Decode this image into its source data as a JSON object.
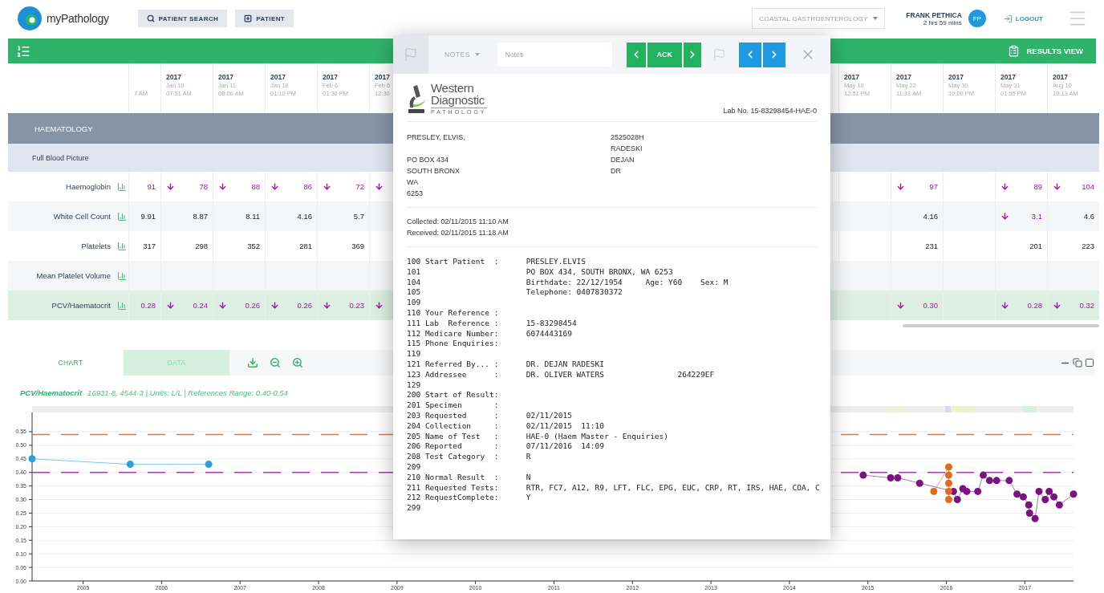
{
  "header": {
    "app_name": "myPathology",
    "buttons": [
      {
        "label": "PATIENT SEARCH"
      },
      {
        "label": "PATIENT"
      }
    ],
    "practice": "COASTAL GASTROENTEROLOGY",
    "user": {
      "name": "FRANK PETHICA",
      "session": "2 hrs 59 mins",
      "initials": "FP"
    },
    "logout": "LOGOUT"
  },
  "toolbar": {
    "view_button": "RESULTS VIEW"
  },
  "results": {
    "left_columns": [
      {
        "time": "7 AM"
      },
      {
        "year": "2017",
        "date": "Jan 10",
        "time": "07:51 AM"
      },
      {
        "year": "2017",
        "date": "Jan 11",
        "time": "08:00 AM"
      },
      {
        "year": "2017",
        "date": "Jan 18",
        "time": "01:10 PM"
      },
      {
        "year": "2017",
        "date": "Feb 6",
        "time": "01:30 PM"
      },
      {
        "year": "2017",
        "date": "Feb 6",
        "time": "12:30"
      }
    ],
    "right_columns": [
      {
        "year": "2017",
        "date": "May 10",
        "time": "12:51 PM"
      },
      {
        "year": "2017",
        "date": "May 22",
        "time": "11:31 AM"
      },
      {
        "year": "2017",
        "date": "May 30",
        "time": "10:00 PM"
      },
      {
        "year": "2017",
        "date": "May 31",
        "time": "01:55 PM"
      },
      {
        "year": "2017",
        "date": "Aug 10",
        "time": "10:13 AM"
      }
    ],
    "group": "HAEMATOLOGY",
    "subgroup": "Full Blood Picture",
    "rows": [
      {
        "name": "Haemoglobin",
        "selected": false,
        "left_cells": [
          {
            "value": "91",
            "arrow": false,
            "abnormal": true
          },
          {
            "value": "78",
            "arrow": true,
            "abnormal": true
          },
          {
            "value": "88",
            "arrow": true,
            "abnormal": true
          },
          {
            "value": "86",
            "arrow": true,
            "abnormal": true
          },
          {
            "value": "72",
            "arrow": true,
            "abnormal": true
          },
          {
            "arrow": true,
            "abnormal": true
          }
        ],
        "right_cells": [
          null,
          {
            "value": "97",
            "arrow": true,
            "abnormal": true
          },
          null,
          {
            "value": "89",
            "arrow": true,
            "abnormal": true
          },
          {
            "value": "104",
            "arrow": true,
            "abnormal": true
          }
        ]
      },
      {
        "name": "White Cell Count",
        "selected": false,
        "left_cells": [
          {
            "value": "9.91",
            "arrow": false,
            "abnormal": false
          },
          {
            "value": "8.87",
            "arrow": false,
            "abnormal": false
          },
          {
            "value": "8.11",
            "arrow": false,
            "abnormal": false
          },
          {
            "value": "4.16",
            "arrow": false,
            "abnormal": false
          },
          {
            "value": "5.7",
            "arrow": false,
            "abnormal": false
          },
          null
        ],
        "right_cells": [
          null,
          {
            "value": "4.16",
            "arrow": false,
            "abnormal": false
          },
          null,
          {
            "value": "3.1",
            "arrow": true,
            "abnormal": true
          },
          {
            "value": "4.6",
            "arrow": false,
            "abnormal": false
          }
        ]
      },
      {
        "name": "Platelets",
        "selected": false,
        "left_cells": [
          {
            "value": "317",
            "arrow": false,
            "abnormal": false
          },
          {
            "value": "298",
            "arrow": false,
            "abnormal": false
          },
          {
            "value": "352",
            "arrow": false,
            "abnormal": false
          },
          {
            "value": "281",
            "arrow": false,
            "abnormal": false
          },
          {
            "value": "369",
            "arrow": false,
            "abnormal": false
          },
          null
        ],
        "right_cells": [
          null,
          {
            "value": "231",
            "arrow": false,
            "abnormal": false
          },
          null,
          {
            "value": "201",
            "arrow": false,
            "abnormal": false
          },
          {
            "value": "223",
            "arrow": false,
            "abnormal": false
          }
        ]
      },
      {
        "name": "Mean Platelet Volume",
        "selected": false,
        "left_cells": [
          null,
          null,
          null,
          null,
          null,
          null
        ],
        "right_cells": [
          null,
          null,
          null,
          null,
          null
        ]
      },
      {
        "name": "PCV/Haematocrit",
        "selected": true,
        "left_cells": [
          {
            "value": "0.28",
            "arrow": false,
            "abnormal": true
          },
          {
            "value": "0.24",
            "arrow": true,
            "abnormal": true
          },
          {
            "value": "0.26",
            "arrow": true,
            "abnormal": true
          },
          {
            "value": "0.26",
            "arrow": true,
            "abnormal": true
          },
          {
            "value": "0.23",
            "arrow": true,
            "abnormal": true
          },
          {
            "arrow": true,
            "abnormal": true
          }
        ],
        "right_cells": [
          null,
          {
            "value": "0.30",
            "arrow": true,
            "abnormal": true
          },
          null,
          {
            "value": "0.28",
            "arrow": true,
            "abnormal": true
          },
          {
            "value": "0.32",
            "arrow": true,
            "abnormal": true
          }
        ]
      }
    ]
  },
  "chart_panel": {
    "tabs": [
      {
        "label": "CHART",
        "selected": true
      },
      {
        "label": "DATA",
        "selected": false
      }
    ],
    "title": "PCV/Haematocrit",
    "details": "16931-8, 4544-3 | Units: L/L | References Range: 0.40-0.54",
    "chart_data": {
      "type": "line",
      "xlim": [
        2004.35,
        2017.62
      ],
      "ylim": [
        0,
        0.615
      ],
      "xticks": [
        2005,
        2006,
        2007,
        2008,
        2009,
        2010,
        2011,
        2012,
        2013,
        2014,
        2015,
        2016,
        2017
      ],
      "yticks": [
        {
          "value": 0,
          "label": "0.00"
        },
        {
          "value": 0.05,
          "label": "0.05"
        },
        {
          "value": 0.1,
          "label": "0.10"
        },
        {
          "value": 0.15,
          "label": "0.15"
        },
        {
          "value": 0.2,
          "label": "0.20"
        },
        {
          "value": 0.25,
          "label": "0.25"
        },
        {
          "value": 0.3,
          "label": "0.30"
        },
        {
          "value": 0.35,
          "label": "0.35"
        },
        {
          "value": 0.4,
          "label": "0.40"
        },
        {
          "value": 0.45,
          "label": "0.45"
        },
        {
          "value": 0.5,
          "label": "0.50"
        },
        {
          "value": 0.55,
          "label": "0.55"
        }
      ],
      "x": [
        2004.35,
        2005.6,
        2006.6,
        2014.94,
        2015.29,
        2015.38,
        2015.66,
        2015.84,
        2016.03,
        2016.03,
        2016.03,
        2016.03,
        2016.03,
        2016.09,
        2016.14,
        2016.21,
        2016.26,
        2016.4,
        2016.47,
        2016.55,
        2016.64,
        2016.8,
        2016.9,
        2016.98,
        2017.05,
        2017.06,
        2017.13,
        2017.18,
        2017.26,
        2017.31,
        2017.37,
        2017.44,
        2017.62
      ],
      "grid": true,
      "series": [
        {
          "color": "#2a9fe0",
          "marker": "o",
          "values": [
            0.45,
            0.43,
            0.43,
            null,
            null,
            null,
            null,
            null,
            null,
            null,
            null,
            null,
            null,
            null,
            null,
            null,
            null,
            null,
            null,
            null,
            null,
            null,
            null,
            null,
            null,
            null,
            null,
            null,
            null,
            null,
            null,
            null,
            null
          ]
        },
        {
          "color": "#7b1282",
          "marker": "o",
          "values": [
            null,
            null,
            null,
            0.39,
            0.38,
            0.38,
            0.36,
            null,
            null,
            null,
            null,
            null,
            null,
            0.33,
            0.3,
            0.34,
            0.33,
            0.33,
            0.39,
            0.37,
            0.37,
            0.37,
            0.32,
            0.31,
            0.28,
            0.25,
            0.23,
            0.33,
            0.3,
            0.33,
            0.31,
            0.28,
            0.32
          ]
        },
        {
          "color": "#e06a1e",
          "marker": "o",
          "values": [
            null,
            null,
            null,
            null,
            null,
            null,
            null,
            0.33,
            0.42,
            0.39,
            0.36,
            0.33,
            0.3,
            null,
            null,
            null,
            null,
            null,
            null,
            null,
            null,
            null,
            null,
            null,
            null,
            null,
            null,
            null,
            null,
            null,
            null,
            null,
            null
          ]
        },
        {
          "color": "#e0763a",
          "line_style": "dashed",
          "values": [
            0.54,
            0.54,
            0.54,
            0.54,
            0.54,
            0.54,
            0.54,
            0.54,
            0.54,
            0.54,
            0.54,
            0.54,
            0.54,
            0.54,
            0.54,
            0.54,
            0.54,
            0.54,
            0.54,
            0.54,
            0.54,
            0.54,
            0.54,
            0.54,
            0.54,
            0.54,
            0.54,
            0.54,
            0.54,
            0.54,
            0.54,
            0.54,
            0.54
          ]
        },
        {
          "color": "#a43cb0",
          "line_style": "dashed",
          "values": [
            0.4,
            0.4,
            0.4,
            0.4,
            0.4,
            0.4,
            0.4,
            0.4,
            0.4,
            0.4,
            0.4,
            0.4,
            0.4,
            0.4,
            0.4,
            0.4,
            0.4,
            0.4,
            0.4,
            0.4,
            0.4,
            0.4,
            0.4,
            0.4,
            0.4,
            0.4,
            0.4,
            0.4,
            0.4,
            0.4,
            0.4,
            0.4,
            0.4
          ]
        }
      ]
    }
  },
  "report_dialog": {
    "notes_menu": "NOTES",
    "notes_placeholder": "Notes",
    "ack": "ACK",
    "logo": {
      "line1": "Western",
      "line2": "Diagnostic",
      "line3": "PATHOLOGY"
    },
    "lab_no": "Lab No. 15-83298454-HAE-0",
    "patient": {
      "name": "PRESLEY, ELVIS,",
      "address": [
        "PO BOX 434",
        "SOUTH BRONX",
        "WA",
        "6253"
      ]
    },
    "doctor": [
      "2525028H",
      "RADESKI",
      "DEJAN",
      "DR"
    ],
    "collected": "Collected: 02/11/2015 11:10 AM",
    "received": "Received: 02/11/2015 11:18 AM",
    "lines": [
      "100 Start Patient  :      PRESLEY.ELVIS",
      "101                       PO BOX 434, SOUTH BRONX, WA 6253",
      "104                       Birthdate: 22/12/1954     Age: Y60    Sex: M",
      "105                       Telephone: 0407830372",
      "109",
      "110 Your Reference :",
      "111 Lab  Reference :      15-83298454",
      "112 Medicare Number:      6074443169",
      "115 Phone Enquiries:",
      "119",
      "121 Referred By... :      DR. DEJAN RADESKI",
      "123 Addressee      :      DR. OLIVER WATERS                264229EF",
      "129",
      "200 Start of Result:",
      "201 Specimen       :",
      "203 Requested      :      02/11/2015",
      "204 Collection     :      02/11/2015  11:10",
      "205 Name of Test   :      HAE-0 (Haem Master - Enquiries)",
      "206 Reported       :      07/11/2016  14:09",
      "208 Test Category  :      R",
      "209",
      "210 Normal Result  :      N",
      "211 Requested Tests:      RTR, FC7, A12, R9, LFT, FLC, EPG, EUC, CRP, RT, IRS, HAE, COA, C",
      "212 RequestComplete:      Y",
      "299"
    ]
  }
}
